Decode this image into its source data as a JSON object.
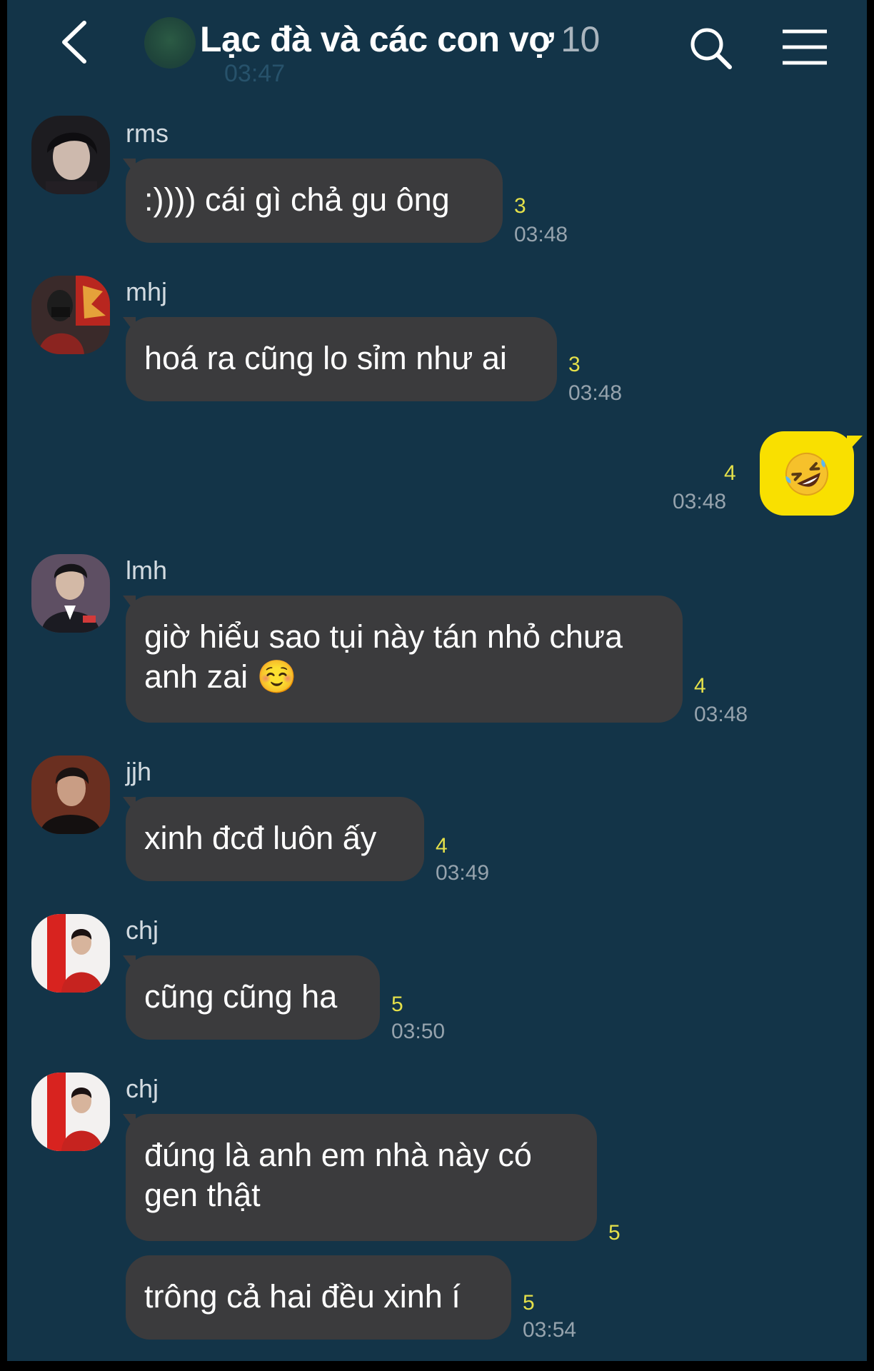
{
  "header": {
    "title": "Lạc đà và các con vợ",
    "member_count": "10"
  },
  "ghost": {
    "time": "03:47"
  },
  "messages": [
    {
      "sender": "rms",
      "text": ":)))) cái gì chả gu ông",
      "unread": "3",
      "time": "03:48"
    },
    {
      "sender": "mhj",
      "text": "hoá ra cũng lo sỉm như ai",
      "unread": "3",
      "time": "03:48"
    },
    {
      "sender": "lmh",
      "text": "giờ hiểu sao tụi này tán nhỏ chưa\nanh zai ☺️",
      "unread": "4",
      "time": "03:48"
    },
    {
      "sender": "jjh",
      "text": "xinh đcđ luôn ấy",
      "unread": "4",
      "time": "03:49"
    },
    {
      "sender": "chj",
      "text": "cũng cũng ha",
      "unread": "5",
      "time": "03:50"
    },
    {
      "sender": "chj",
      "text": "đúng là anh em nhà này có\ngen thật",
      "unread": "5"
    },
    {
      "text": "trông cả hai đều xinh í",
      "unread": "5",
      "time": "03:54"
    }
  ],
  "my_message": {
    "emoji": "rolling-on-floor-laughing",
    "unread": "4",
    "time": "03:48"
  },
  "colors": {
    "background": "#133448",
    "bubble_other": "#3b3b3d",
    "bubble_mine": "#f9e000",
    "unread": "#e4e04a"
  }
}
